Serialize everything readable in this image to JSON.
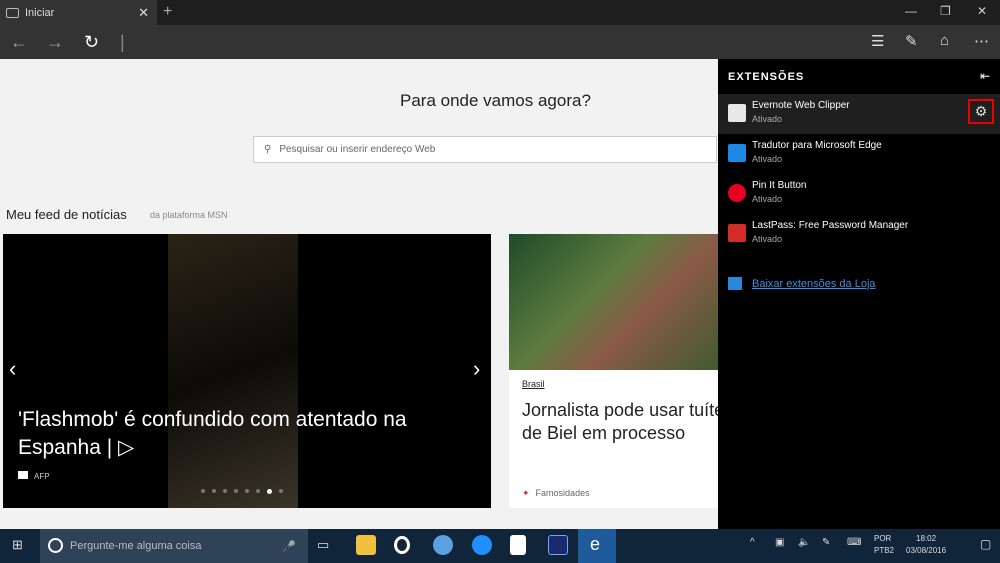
{
  "tab": {
    "title": "Iniciar"
  },
  "main": {
    "headline": "Para onde vamos agora?",
    "search_placeholder": "Pesquisar ou inserir endereço Web",
    "feed_title": "Meu feed de notícias",
    "feed_source": "da plataforma MSN",
    "card1": {
      "title": "'Flashmob' é confundido com atentado na Espanha | ▷",
      "source": "AFP",
      "slides": 8,
      "active_slide": 7
    },
    "card2": {
      "category": "Brasil",
      "title_line1": "Jornalista pode usar tuítes",
      "title_line2": "de Biel em processo",
      "source": "Famosidades"
    }
  },
  "panel": {
    "title": "EXTENSÕES",
    "extensions": [
      {
        "name": "Evernote Web Clipper",
        "status": "Ativado",
        "color": "#e8e8e8"
      },
      {
        "name": "Tradutor para Microsoft Edge",
        "status": "Ativado",
        "color": "#1e88e5"
      },
      {
        "name": "Pin It Button",
        "status": "Ativado",
        "color": "#e60023"
      },
      {
        "name": "LastPass: Free Password Manager",
        "status": "Ativado",
        "color": "#d32d27"
      }
    ],
    "store_link": "Baixar extensões da Loja"
  },
  "taskbar": {
    "search_placeholder": "Pergunte-me alguma coisa",
    "lang1": "POR",
    "lang2": "PTB2",
    "time": "18:02",
    "date": "03/08/2016"
  }
}
